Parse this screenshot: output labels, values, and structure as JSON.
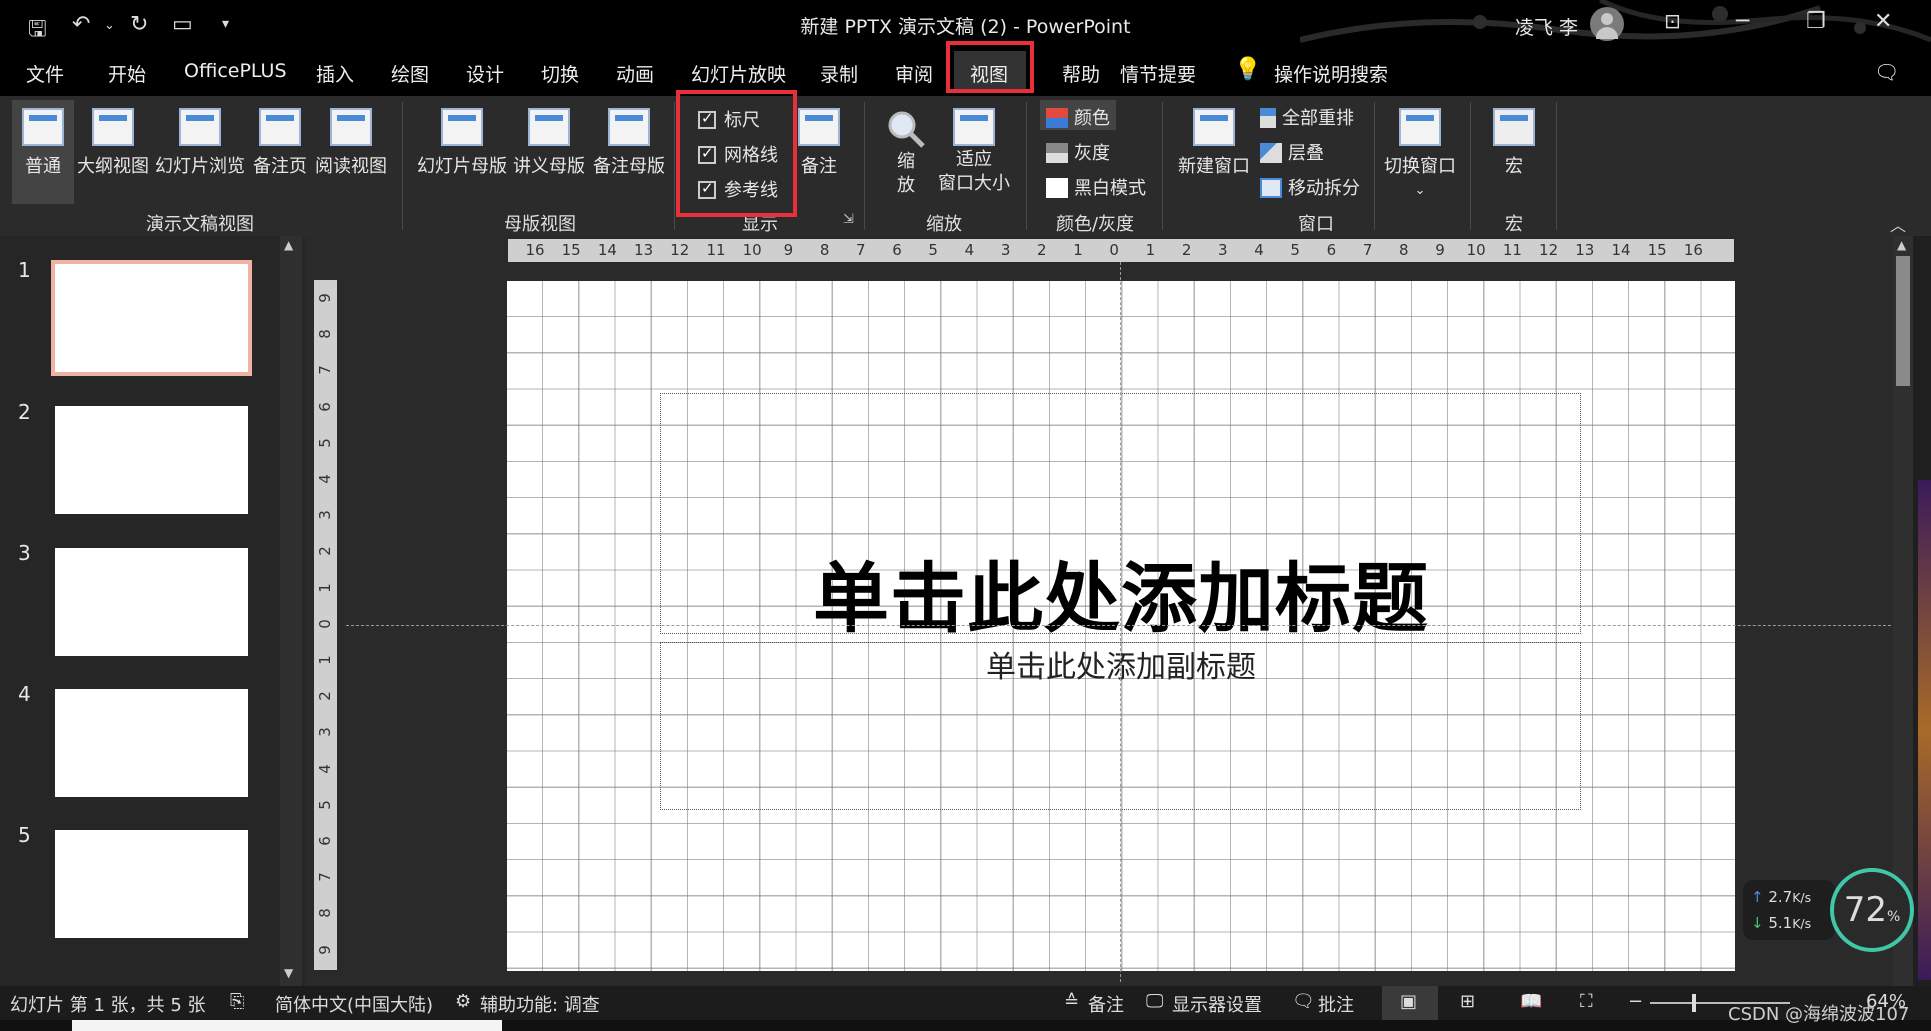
{
  "window": {
    "title": "新建 PPTX 演示文稿 (2)  -  PowerPoint",
    "user": "凌飞 李"
  },
  "menu_tabs": [
    "文件",
    "开始",
    "OfficePLUS",
    "插入",
    "绘图",
    "设计",
    "切换",
    "动画",
    "幻灯片放映",
    "录制",
    "审阅",
    "视图",
    "帮助",
    "情节提要"
  ],
  "search_label": "操作说明搜索",
  "ribbon": {
    "presentation_views": {
      "label": "演示文稿视图",
      "buttons": [
        "普通",
        "大纲视图",
        "幻灯片浏览",
        "备注页",
        "阅读视图"
      ]
    },
    "master_views": {
      "label": "母版视图",
      "buttons": [
        "幻灯片母版",
        "讲义母版",
        "备注母版"
      ]
    },
    "show": {
      "label": "显示",
      "checkboxes": [
        {
          "label": "标尺",
          "checked": true
        },
        {
          "label": "网格线",
          "checked": true
        },
        {
          "label": "参考线",
          "checked": true
        }
      ],
      "notes_button": "备注"
    },
    "zoom": {
      "label": "缩放",
      "zoom_button_line1": "缩",
      "zoom_button_line2": "放",
      "fit_button_line1": "适应",
      "fit_button_line2": "窗口大小"
    },
    "color": {
      "label": "颜色/灰度",
      "buttons": [
        "颜色",
        "灰度",
        "黑白模式"
      ]
    },
    "window": {
      "label": "窗口",
      "new_window": "新建窗口",
      "buttons": [
        "全部重排",
        "层叠",
        "移动拆分"
      ],
      "switch_window": "切换窗口"
    },
    "macros": {
      "label": "宏",
      "button": "宏"
    }
  },
  "thumbnails": [
    "1",
    "2",
    "3",
    "4",
    "5"
  ],
  "rulers": {
    "horizontal": [
      "16",
      "15",
      "14",
      "13",
      "12",
      "11",
      "10",
      "9",
      "8",
      "7",
      "6",
      "5",
      "4",
      "3",
      "2",
      "1",
      "0",
      "1",
      "2",
      "3",
      "4",
      "5",
      "6",
      "7",
      "8",
      "9",
      "10",
      "11",
      "12",
      "13",
      "14",
      "15",
      "16"
    ],
    "vertical": [
      "9",
      "8",
      "7",
      "6",
      "5",
      "4",
      "3",
      "2",
      "1",
      "0",
      "1",
      "2",
      "3",
      "4",
      "5",
      "6",
      "7",
      "8",
      "9"
    ]
  },
  "slide": {
    "title": "单击此处添加标题",
    "subtitle": "单击此处添加副标题"
  },
  "status": {
    "slide_info": "幻灯片 第 1 张，共 5 张",
    "language": "简体中文(中国大陆)",
    "accessibility": "辅助功能: 调查",
    "notes": "备注",
    "display_settings": "显示器设置",
    "comments": "批注",
    "zoom": "64%"
  },
  "network": {
    "upload": "2.7",
    "download": "5.1",
    "unit": "K/s",
    "cpu": "72",
    "cpu_unit": "%"
  },
  "watermark": "CSDN @海绵波波107"
}
